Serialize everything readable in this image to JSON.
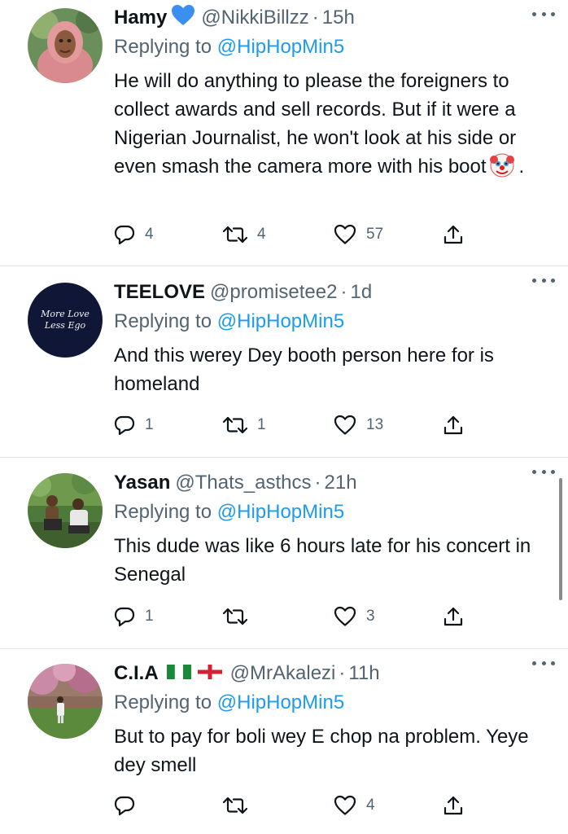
{
  "tweets": [
    {
      "display_name": "Hamy",
      "handle": "@NikkiBillzz",
      "separator": "·",
      "time": "15h",
      "replying_prefix": "Replying to",
      "replying_to": "@HipHopMin5",
      "text": "He will do anything to please the foreigners to collect awards and sell records. But if it were a Nigerian Journalist, he won't look at his side or even smash the camera more with his boot",
      "text_suffix": ".",
      "replies": "4",
      "retweets": "4",
      "likes": "57"
    },
    {
      "display_name": "TEELOVE",
      "handle": "@promisetee2",
      "separator": "·",
      "time": "1d",
      "avatar_text_1": "More Love",
      "avatar_text_2": "Less Ego",
      "replying_prefix": "Replying to",
      "replying_to": "@HipHopMin5",
      "text": "And this werey Dey booth person here for is homeland",
      "replies": "1",
      "retweets": "1",
      "likes": "13"
    },
    {
      "display_name": "Yasan",
      "handle": "@Thats_asthcs",
      "separator": "·",
      "time": "21h",
      "replying_prefix": "Replying to",
      "replying_to": "@HipHopMin5",
      "text": "This dude was like 6 hours late for his concert in Senegal",
      "replies": "1",
      "retweets": "",
      "likes": "3"
    },
    {
      "display_name": "C.I.A",
      "handle": "@MrAkalezi",
      "separator": "·",
      "time": "11h",
      "replying_prefix": "Replying to",
      "replying_to": "@HipHopMin5",
      "text": "But to pay for boli wey E chop na problem. Yeye dey smell",
      "replies": "",
      "retweets": "",
      "likes": "4"
    }
  ],
  "icons": {
    "reply": "reply-icon",
    "retweet": "retweet-icon",
    "like": "heart-icon",
    "share": "share-icon",
    "more": "more-icon",
    "verified_heart": "blue-heart-icon",
    "clown": "clown-emoji-icon",
    "flag_nigeria": "nigeria-flag-icon",
    "flag_england": "england-flag-icon"
  },
  "colors": {
    "text": "#0f1419",
    "secondary": "#536471",
    "link": "#1d9bf0",
    "divider": "#e3e7ea"
  }
}
